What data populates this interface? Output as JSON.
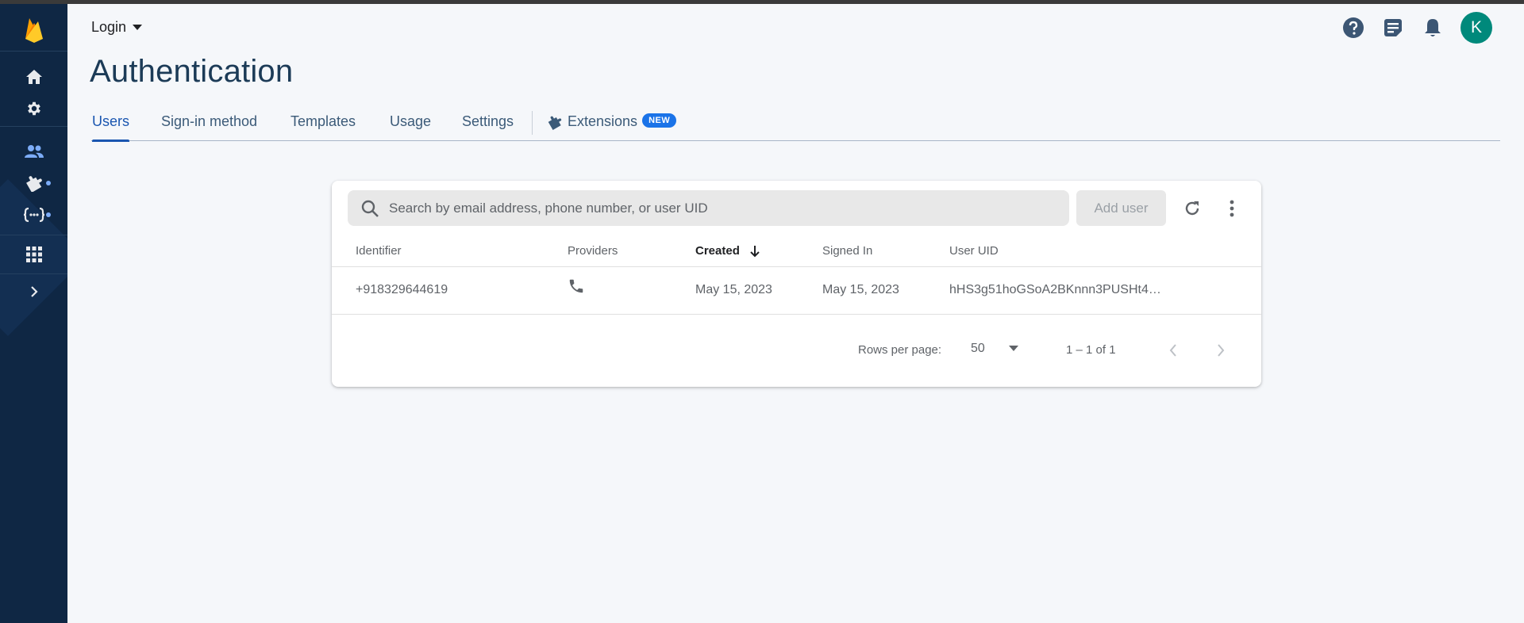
{
  "header": {
    "breadcrumb": "Login",
    "title": "Authentication",
    "avatar_letter": "K"
  },
  "sidebar": {
    "items": [
      {
        "icon": "firebase-logo"
      },
      {
        "icon": "home-icon"
      },
      {
        "icon": "gear-icon"
      },
      {
        "icon": "users-icon"
      },
      {
        "icon": "extensions-icon"
      },
      {
        "icon": "functions-icon"
      },
      {
        "icon": "apps-grid-icon"
      },
      {
        "icon": "expand-icon"
      }
    ]
  },
  "tabs": [
    {
      "label": "Users",
      "active": true
    },
    {
      "label": "Sign-in method"
    },
    {
      "label": "Templates"
    },
    {
      "label": "Usage"
    },
    {
      "label": "Settings"
    },
    {
      "label": "Extensions",
      "badge": "NEW"
    }
  ],
  "search": {
    "placeholder": "Search by email address, phone number, or user UID"
  },
  "add_user_label": "Add user",
  "table": {
    "columns": [
      "Identifier",
      "Providers",
      "Created",
      "Signed In",
      "User UID"
    ],
    "sorted_column": "Created",
    "rows": [
      {
        "identifier": "+918329644619",
        "provider": "phone-icon",
        "created": "May 15, 2023",
        "signed_in": "May 15, 2023",
        "uid": "hHS3g51hoGSoA2BKnnn3PUSHt4…"
      }
    ]
  },
  "pagination": {
    "rows_per_page_label": "Rows per page:",
    "rows_per_page_value": "50",
    "range": "1 – 1 of 1"
  },
  "colors": {
    "rail": "#0f2744",
    "accent": "#1a56b0",
    "badge": "#1a73e8",
    "avatar": "#00897b"
  }
}
